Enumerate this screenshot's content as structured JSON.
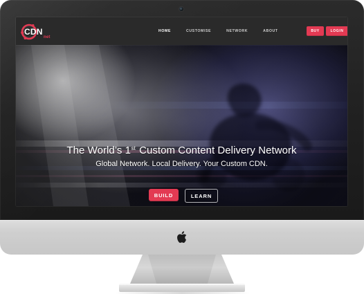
{
  "site": {
    "brand": {
      "name": "CDN",
      "suffix": "net"
    },
    "nav": {
      "items": [
        {
          "label": "HOME",
          "active": true
        },
        {
          "label": "CUSTOMISE",
          "active": false
        },
        {
          "label": "NETWORK",
          "active": false
        },
        {
          "label": "ABOUT",
          "active": false
        }
      ],
      "buttons": {
        "buy": "BUY",
        "login": "LOGIN"
      }
    },
    "hero": {
      "title": {
        "prefix": "The World’s 1",
        "superscript": "st",
        "suffix": " Custom Content Delivery Network"
      },
      "subtitle": "Global Network. Local Delivery. Your Custom CDN.",
      "buttons": {
        "build": "BUILD",
        "learn": "LEARN"
      }
    }
  },
  "colors": {
    "accent": "#e33a53",
    "navbar": "#2a2a2a",
    "bezel": "#202020",
    "chin": "#cfcfcf"
  },
  "icons": {
    "webcam": "webcam-icon",
    "apple": "apple-logo-icon"
  }
}
